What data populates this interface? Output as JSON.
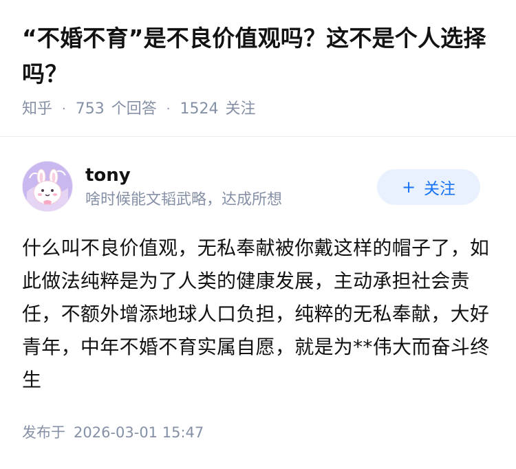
{
  "question": {
    "title": "“不婚不育”是不良价值观吗？这不是个人选择吗？",
    "source": "知乎",
    "separator": "·",
    "answer_count": "753",
    "answer_label": "个回答",
    "follower_count": "1524",
    "follower_label": "关注"
  },
  "author": {
    "name": "tony",
    "bio": "啥时候能文韬武略，达成所想",
    "avatar_icon": "cartoon-bunny-avatar",
    "follow_plus": "+",
    "follow_label": "关注"
  },
  "answer": {
    "content": "什么叫不良价值观，无私奉献被你戴这样的帽子了，如此做法纯粹是为了人类的健康发展，主动承担社会责任，不额外增添地球人口负担，纯粹的无私奉献，大好青年，中年不婚不育实属自愿，就是为**伟大而奋斗终生"
  },
  "footer": {
    "published_label": "发布于",
    "published_time": "2026-03-01 15:47"
  },
  "colors": {
    "text": "#121212",
    "muted": "#8590a6",
    "accent": "#1772f6",
    "accent_bg": "#e8f1fd"
  }
}
